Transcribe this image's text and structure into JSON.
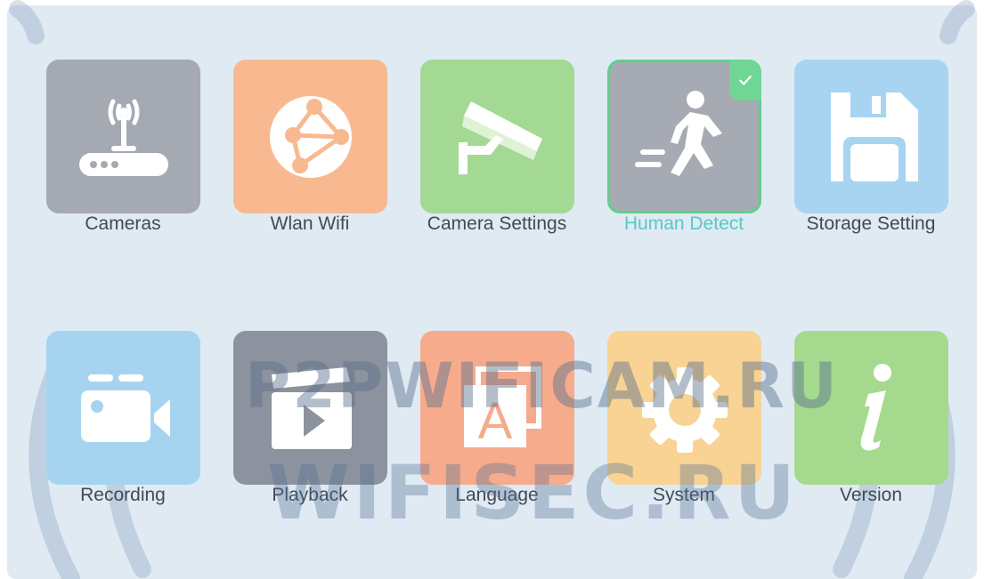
{
  "menu": {
    "items": [
      {
        "label": "Cameras",
        "icon": "router-antenna-icon",
        "color": "#a4a9b2"
      },
      {
        "label": "Wlan Wifi",
        "icon": "network-globe-icon",
        "color": "#f8b991"
      },
      {
        "label": "Camera Settings",
        "icon": "security-camera-icon",
        "color": "#a4d994"
      },
      {
        "label": "Human Detect",
        "icon": "walking-person-icon",
        "color": "#a6aab3",
        "selected": true
      },
      {
        "label": "Storage Setting",
        "icon": "floppy-disk-icon",
        "color": "#a8d4f1"
      },
      {
        "label": "Recording",
        "icon": "video-camera-icon",
        "color": "#a6d4f0"
      },
      {
        "label": "Playback",
        "icon": "clapperboard-play-icon",
        "color": "#8c939e"
      },
      {
        "label": "Language",
        "icon": "language-a-icon",
        "color": "#f5ab8c"
      },
      {
        "label": "System",
        "icon": "gear-icon",
        "color": "#f8d394"
      },
      {
        "label": "Version",
        "icon": "info-icon",
        "color": "#a5d98e"
      }
    ]
  },
  "watermark": {
    "line1": "P2PWIFICAM.RU",
    "line2": "WIFISEC.RU"
  },
  "colors": {
    "background": "#dfeaf3",
    "label_text": "#424a55",
    "active_label": "#58c8c8",
    "selection_accent": "#6fd694"
  }
}
